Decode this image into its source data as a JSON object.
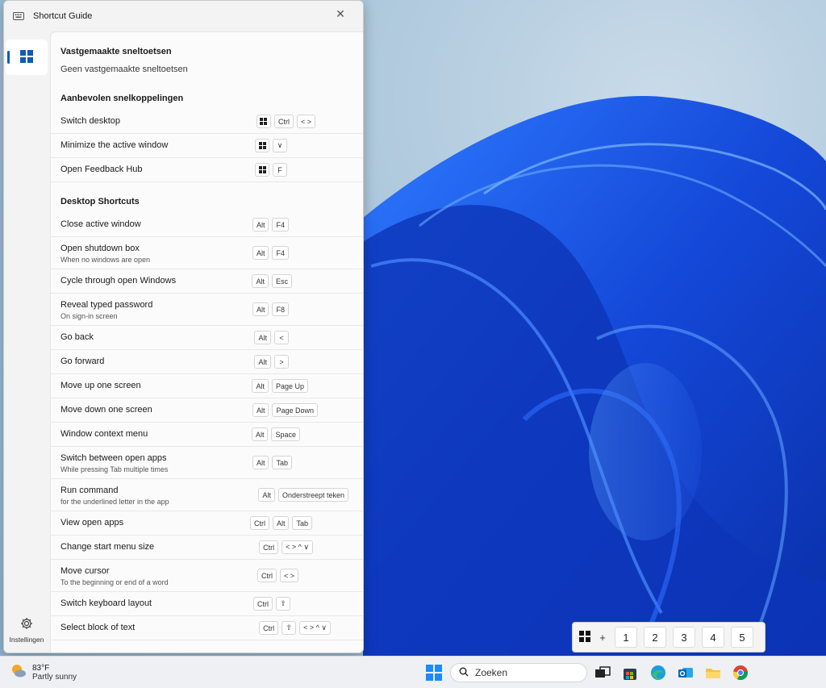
{
  "window": {
    "title": "Shortcut Guide",
    "close_glyph": "✕"
  },
  "sidebar": {
    "settings_label": "Instellingen"
  },
  "pinned": {
    "title": "Vastgemaakte sneltoetsen",
    "empty_text": "Geen vastgemaakte sneltoetsen"
  },
  "recommended": {
    "title": "Aanbevolen snelkoppelingen",
    "items": [
      {
        "name": "Switch desktop",
        "keys": [
          "WIN",
          "Ctrl",
          "< >"
        ]
      },
      {
        "name": "Minimize the active window",
        "keys": [
          "WIN",
          "∨"
        ]
      },
      {
        "name": "Open Feedback Hub",
        "keys": [
          "WIN",
          "F"
        ]
      }
    ]
  },
  "desktop": {
    "title": "Desktop Shortcuts",
    "items": [
      {
        "name": "Close active window",
        "desc": "",
        "keys": [
          "Alt",
          "F4"
        ]
      },
      {
        "name": "Open shutdown box",
        "desc": "When no windows are open",
        "keys": [
          "Alt",
          "F4"
        ]
      },
      {
        "name": "Cycle through open Windows",
        "desc": "",
        "keys": [
          "Alt",
          "Esc"
        ]
      },
      {
        "name": "Reveal typed password",
        "desc": "On sign-in screen",
        "keys": [
          "Alt",
          "F8"
        ]
      },
      {
        "name": "Go back",
        "desc": "",
        "keys": [
          "Alt",
          "<"
        ]
      },
      {
        "name": "Go forward",
        "desc": "",
        "keys": [
          "Alt",
          ">"
        ]
      },
      {
        "name": "Move up one screen",
        "desc": "",
        "keys": [
          "Alt",
          "Page Up"
        ]
      },
      {
        "name": "Move down one screen",
        "desc": "",
        "keys": [
          "Alt",
          "Page Down"
        ]
      },
      {
        "name": "Window context menu",
        "desc": "",
        "keys": [
          "Alt",
          "Space"
        ]
      },
      {
        "name": "Switch between open apps",
        "desc": "While pressing Tab multiple times",
        "keys": [
          "Alt",
          "Tab"
        ]
      },
      {
        "name": "Run command",
        "desc": "for the underlined letter in the app",
        "keys": [
          "Alt",
          "Onderstreept teken"
        ]
      },
      {
        "name": "View open apps",
        "desc": "",
        "keys": [
          "Ctrl",
          "Alt",
          "Tab"
        ]
      },
      {
        "name": "Change start menu size",
        "desc": "",
        "keys": [
          "Ctrl",
          "< > ^ ∨"
        ]
      },
      {
        "name": "Move cursor",
        "desc": "To the beginning or end of a word",
        "keys": [
          "Ctrl",
          "< >"
        ]
      },
      {
        "name": "Switch keyboard layout",
        "desc": "",
        "keys": [
          "Ctrl",
          "⇧"
        ]
      },
      {
        "name": "Select block of text",
        "desc": "",
        "keys": [
          "Ctrl",
          "⇧",
          "< > ^ ∨"
        ]
      }
    ]
  },
  "virtual_desktops": {
    "plus": "+",
    "numbers": [
      "1",
      "2",
      "3",
      "4",
      "5"
    ]
  },
  "taskbar": {
    "temperature": "83°F",
    "condition": "Partly sunny",
    "search_placeholder": "Zoeken"
  },
  "colors": {
    "accent": "#0f5bb5",
    "wallpaper_blue": "#1a55e8"
  }
}
